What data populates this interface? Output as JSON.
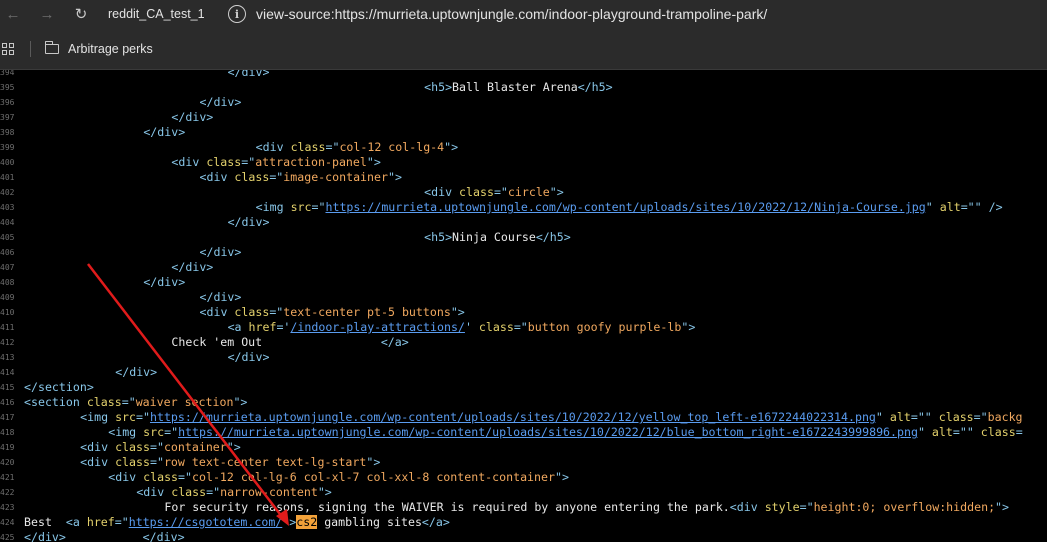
{
  "browser": {
    "tab_title": "reddit_CA_test_1",
    "url": "view-source:https://murrieta.uptownjungle.com/indoor-playground-trampoline-park/"
  },
  "bookmarks": [
    {
      "label": "Arbitrage perks",
      "icon": "folder-icon"
    }
  ],
  "source_lines": [
    {
      "n": "394",
      "i": 29,
      "s": [
        [
          "</div>",
          "t"
        ]
      ]
    },
    {
      "n": "395",
      "i": 57,
      "s": [
        [
          "<h5>",
          "t"
        ],
        [
          "Ball Blaster Arena",
          "x"
        ],
        [
          "</h5>",
          "t"
        ]
      ]
    },
    {
      "n": "396",
      "i": 25,
      "s": [
        [
          "</div>",
          "t"
        ]
      ]
    },
    {
      "n": "397",
      "i": 21,
      "s": [
        [
          "</div>",
          "t"
        ]
      ]
    },
    {
      "n": "398",
      "i": 17,
      "s": [
        [
          "</div>",
          "t"
        ]
      ]
    },
    {
      "n": "399",
      "i": 33,
      "s": [
        [
          "<div ",
          "t"
        ],
        [
          "class",
          "a"
        ],
        [
          "=\"",
          "t"
        ],
        [
          "col-12 col-lg-4",
          "v"
        ],
        [
          "\">",
          "t"
        ]
      ]
    },
    {
      "n": "400",
      "i": 21,
      "s": [
        [
          "<div ",
          "t"
        ],
        [
          "class",
          "a"
        ],
        [
          "=\"",
          "t"
        ],
        [
          "attraction-panel",
          "v"
        ],
        [
          "\">",
          "t"
        ]
      ]
    },
    {
      "n": "401",
      "i": 25,
      "s": [
        [
          "<div ",
          "t"
        ],
        [
          "class",
          "a"
        ],
        [
          "=\"",
          "t"
        ],
        [
          "image-container",
          "v"
        ],
        [
          "\">",
          "t"
        ]
      ]
    },
    {
      "n": "402",
      "i": 57,
      "s": [
        [
          "<div ",
          "t"
        ],
        [
          "class",
          "a"
        ],
        [
          "=\"",
          "t"
        ],
        [
          "circle",
          "v"
        ],
        [
          "\">",
          "t"
        ]
      ]
    },
    {
      "n": "403",
      "i": 33,
      "s": [
        [
          "<img ",
          "t"
        ],
        [
          "src",
          "a"
        ],
        [
          "=\"",
          "t"
        ],
        [
          "https://murrieta.uptownjungle.com/wp-content/uploads/sites/10/2022/12/Ninja-Course.jpg",
          "u"
        ],
        [
          "\" ",
          "t"
        ],
        [
          "alt",
          "a"
        ],
        [
          "=\"\" />",
          "t"
        ]
      ]
    },
    {
      "n": "404",
      "i": 29,
      "s": [
        [
          "</div>",
          "t"
        ]
      ]
    },
    {
      "n": "405",
      "i": 57,
      "s": [
        [
          "<h5>",
          "t"
        ],
        [
          "Ninja Course",
          "x"
        ],
        [
          "</h5>",
          "t"
        ]
      ]
    },
    {
      "n": "406",
      "i": 25,
      "s": [
        [
          "</div>",
          "t"
        ]
      ]
    },
    {
      "n": "407",
      "i": 21,
      "s": [
        [
          "</div>",
          "t"
        ]
      ]
    },
    {
      "n": "408",
      "i": 17,
      "s": [
        [
          "</div>",
          "t"
        ]
      ]
    },
    {
      "n": "409",
      "i": 25,
      "s": [
        [
          "</div>",
          "t"
        ]
      ]
    },
    {
      "n": "410",
      "i": 25,
      "s": [
        [
          "<div ",
          "t"
        ],
        [
          "class",
          "a"
        ],
        [
          "=\"",
          "t"
        ],
        [
          "text-center pt-5 buttons",
          "v"
        ],
        [
          "\">",
          "t"
        ]
      ]
    },
    {
      "n": "411",
      "i": 29,
      "s": [
        [
          "<a ",
          "t"
        ],
        [
          "href",
          "a"
        ],
        [
          "='",
          "t"
        ],
        [
          "/indoor-play-attractions/",
          "u"
        ],
        [
          "' ",
          "t"
        ],
        [
          "class",
          "a"
        ],
        [
          "=\"",
          "t"
        ],
        [
          "button goofy purple-lb",
          "v"
        ],
        [
          "\">",
          "t"
        ]
      ]
    },
    {
      "n": "412",
      "i": 21,
      "s": [
        [
          "Check 'em Out                 ",
          "x"
        ],
        [
          "</a>",
          "t"
        ]
      ]
    },
    {
      "n": "413",
      "i": 29,
      "s": [
        [
          "</div>",
          "t"
        ]
      ]
    },
    {
      "n": "414",
      "i": 13,
      "s": [
        [
          "</div>",
          "t"
        ]
      ]
    },
    {
      "n": "415",
      "i": 0,
      "s": [
        [
          "</section>",
          "t"
        ]
      ]
    },
    {
      "n": "416",
      "i": 0,
      "s": [
        [
          "<section ",
          "t"
        ],
        [
          "class",
          "a"
        ],
        [
          "=\"",
          "t"
        ],
        [
          "waiver section",
          "v"
        ],
        [
          "\">",
          "t"
        ]
      ]
    },
    {
      "n": "417",
      "i": 8,
      "s": [
        [
          "<img ",
          "t"
        ],
        [
          "src",
          "a"
        ],
        [
          "=\"",
          "t"
        ],
        [
          "https://murrieta.uptownjungle.com/wp-content/uploads/sites/10/2022/12/yellow_top_left-e1672244022314.png",
          "u"
        ],
        [
          "\" ",
          "t"
        ],
        [
          "alt",
          "a"
        ],
        [
          "=\"\" ",
          "t"
        ],
        [
          "class",
          "a"
        ],
        [
          "=\"",
          "t"
        ],
        [
          "backg",
          "v"
        ]
      ]
    },
    {
      "n": "418",
      "i": 12,
      "s": [
        [
          "<img ",
          "t"
        ],
        [
          "src",
          "a"
        ],
        [
          "=\"",
          "t"
        ],
        [
          "https://murrieta.uptownjungle.com/wp-content/uploads/sites/10/2022/12/blue_bottom_right-e1672243999896.png",
          "u"
        ],
        [
          "\" ",
          "t"
        ],
        [
          "alt",
          "a"
        ],
        [
          "=\"\" ",
          "t"
        ],
        [
          "class",
          "a"
        ],
        [
          "=",
          "t"
        ]
      ]
    },
    {
      "n": "419",
      "i": 8,
      "s": [
        [
          "<div ",
          "t"
        ],
        [
          "class",
          "a"
        ],
        [
          "=\"",
          "t"
        ],
        [
          "container",
          "v"
        ],
        [
          "\">",
          "t"
        ]
      ]
    },
    {
      "n": "420",
      "i": 8,
      "s": [
        [
          "<div ",
          "t"
        ],
        [
          "class",
          "a"
        ],
        [
          "=\"",
          "t"
        ],
        [
          "row text-center text-lg-start",
          "v"
        ],
        [
          "\">",
          "t"
        ]
      ]
    },
    {
      "n": "421",
      "i": 12,
      "s": [
        [
          "<div ",
          "t"
        ],
        [
          "class",
          "a"
        ],
        [
          "=\"",
          "t"
        ],
        [
          "col-12 col-lg-6 col-xl-7 col-xxl-8 content-container",
          "v"
        ],
        [
          "\">",
          "t"
        ]
      ]
    },
    {
      "n": "422",
      "i": 16,
      "s": [
        [
          "<div ",
          "t"
        ],
        [
          "class",
          "a"
        ],
        [
          "=\"",
          "t"
        ],
        [
          "narrow-content",
          "v"
        ],
        [
          "\">",
          "t"
        ]
      ]
    },
    {
      "n": "423",
      "i": 20,
      "s": [
        [
          "For security reasons, signing the WAIVER is required by anyone entering the park.",
          "x"
        ],
        [
          "<div ",
          "t"
        ],
        [
          "style",
          "a"
        ],
        [
          "=\"",
          "t"
        ],
        [
          "height:0; overflow:hidden;",
          "v"
        ],
        [
          "\">",
          "t"
        ]
      ]
    },
    {
      "n": "424",
      "i": 0,
      "s": [
        [
          "Best  ",
          "x"
        ],
        [
          "<a ",
          "t"
        ],
        [
          "href",
          "a"
        ],
        [
          "=\"",
          "t"
        ],
        [
          "https://csgototem.com/",
          "u"
        ],
        [
          "\">",
          "t"
        ],
        [
          "cs2",
          "hl"
        ],
        [
          " gambling sites",
          "x"
        ],
        [
          "</a>",
          "t"
        ]
      ]
    },
    {
      "n": "425",
      "i": 0,
      "s": [
        [
          "</div>",
          "t"
        ],
        [
          "           ",
          "x"
        ],
        [
          "</div>",
          "t"
        ]
      ]
    }
  ],
  "annotation": {
    "color": "#e01b1b"
  }
}
